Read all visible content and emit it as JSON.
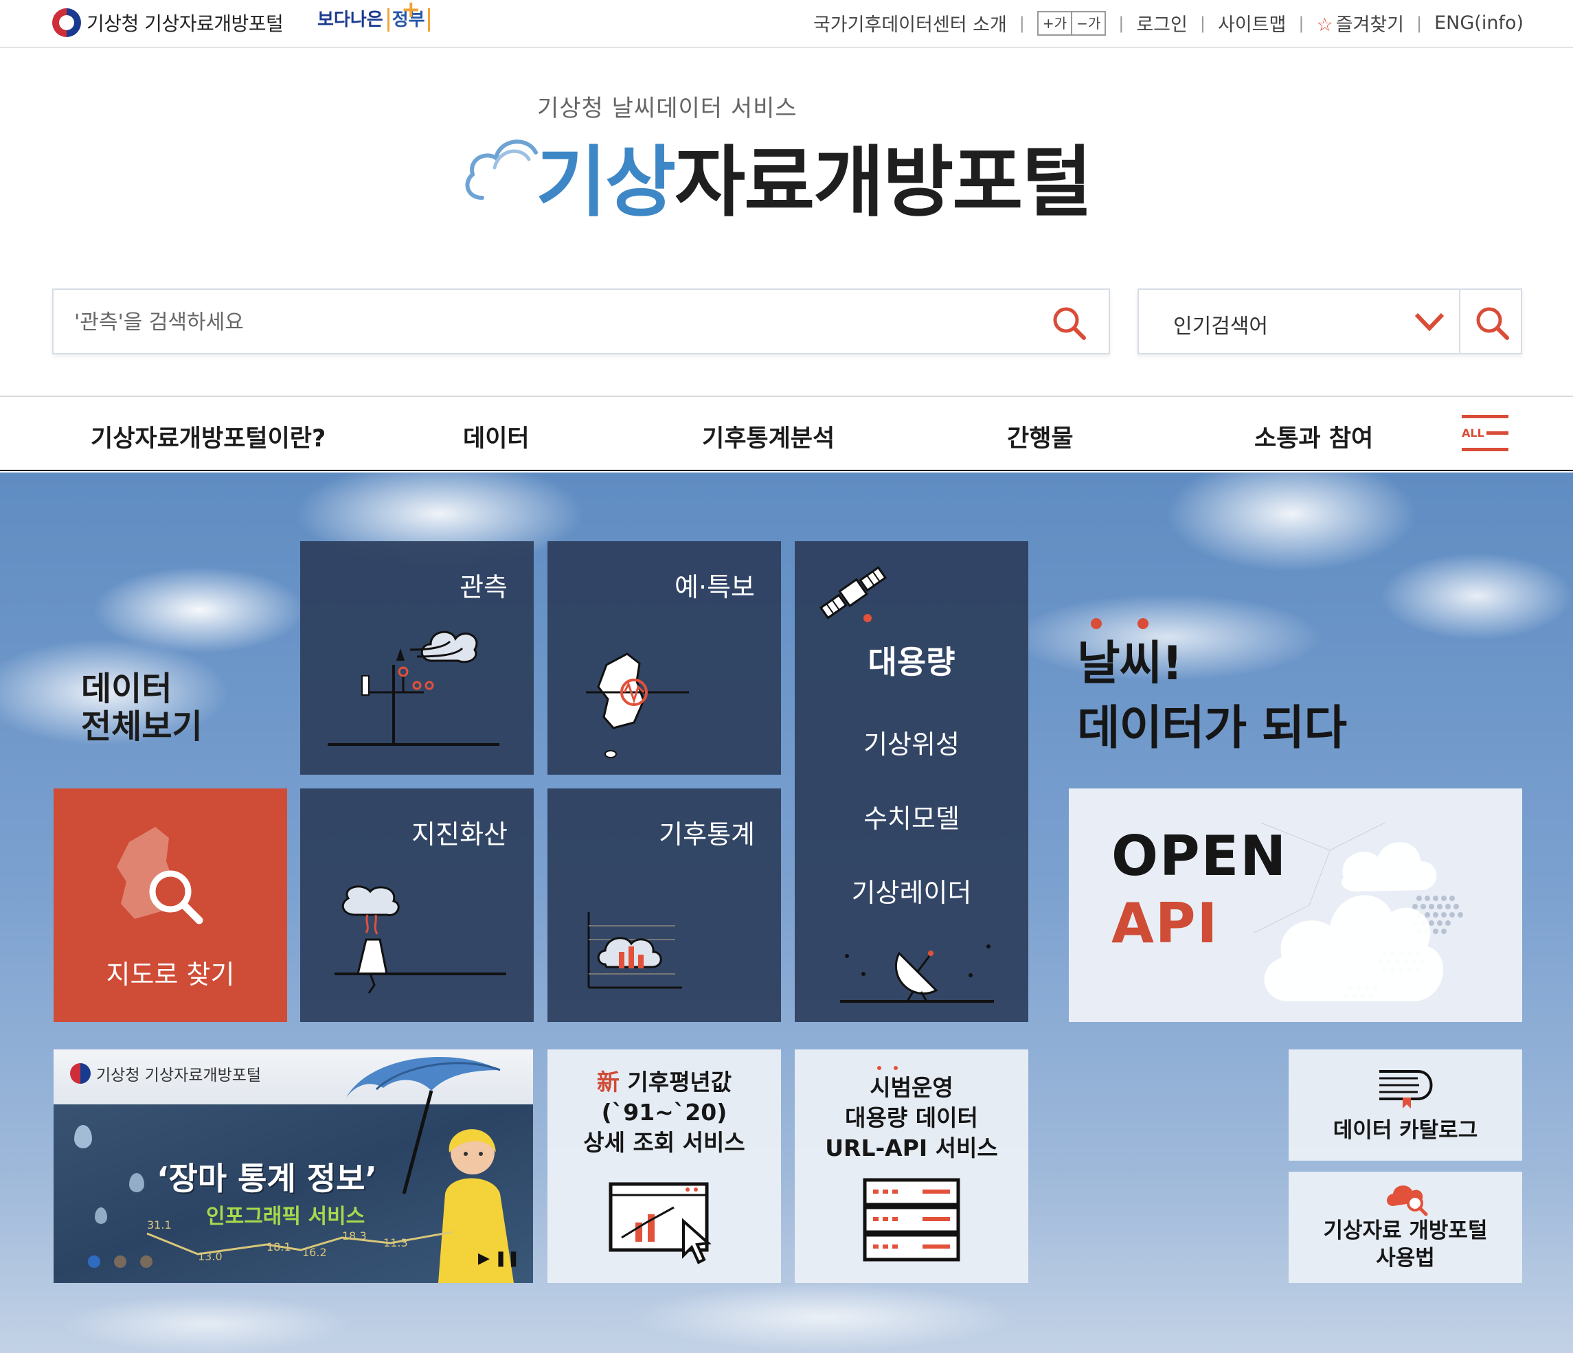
{
  "topbar": {
    "org": "기상청 기상자료개방포털",
    "slogan_a": "보다나은",
    "slogan_b": "정부",
    "slogan_plus": "+",
    "links": {
      "about": "국가기후데이터센터 소개",
      "font_up": "+가",
      "font_down": "−가",
      "login": "로그인",
      "sitemap": "사이트맵",
      "favorite": "즐겨찾기",
      "english": "ENG(info)"
    },
    "separator": "|"
  },
  "brand": {
    "subtitle": "기상청 날씨데이터 서비스",
    "title_accent": "기상",
    "title_rest": "자료개방포털"
  },
  "search": {
    "placeholder": "'관측'을 검색하세요",
    "popular_label": "인기검색어"
  },
  "gnb": {
    "items": [
      "기상자료개방포털이란?",
      "데이터",
      "기후통계분석",
      "간행물",
      "소통과 참여"
    ],
    "all_label": "ALL"
  },
  "hero": {
    "view_all_line1": "데이터",
    "view_all_line2": "전체보기",
    "tiles": {
      "observation": "관측",
      "forecast": "예·특보",
      "earthquake": "지진화산",
      "climate_stats": "기후통계",
      "map_search": "지도로 찾기"
    },
    "bigdata": {
      "title": "대용량",
      "links": [
        "기상위성",
        "수치모델",
        "기상레이더"
      ]
    },
    "slogan_line1": "날씨!",
    "slogan_line2": "데이터가 되다",
    "openapi_line1": "OPEN",
    "openapi_line2": "API"
  },
  "banner": {
    "org": "기상청 기상자료개방포털",
    "title": "‘장마 통계 정보’",
    "subtitle": "인포그래픽 서비스",
    "points": [
      "31.1",
      "13.0",
      "18.1",
      "16.2",
      "18.3",
      "11.3"
    ],
    "controls": "▶ ❚❚"
  },
  "services": {
    "normals_new": "新",
    "normals_line1": "기후평년값",
    "normals_line2": "(`91~`20)",
    "normals_line3": "상세 조회 서비스",
    "urlapi_line1": "시범운영",
    "urlapi_line2": "대용량 데이터",
    "urlapi_line3": "URL-API 서비스",
    "catalog": "데이터 카탈로그",
    "guide_line1": "기상자료 개방포털",
    "guide_line2": "사용법"
  },
  "colors": {
    "accent_red": "#cf4c36",
    "brand_blue": "#3e87c6",
    "tile_navy": "#2d3e5c"
  },
  "icons": [
    "search-icon",
    "chevron-down-icon",
    "star-icon",
    "hamburger-menu-icon",
    "satellite-icon",
    "radar-dish-icon",
    "volcano-icon",
    "weather-station-icon",
    "korea-map-icon",
    "chart-icon",
    "server-icon",
    "book-icon",
    "cloud-search-icon"
  ]
}
